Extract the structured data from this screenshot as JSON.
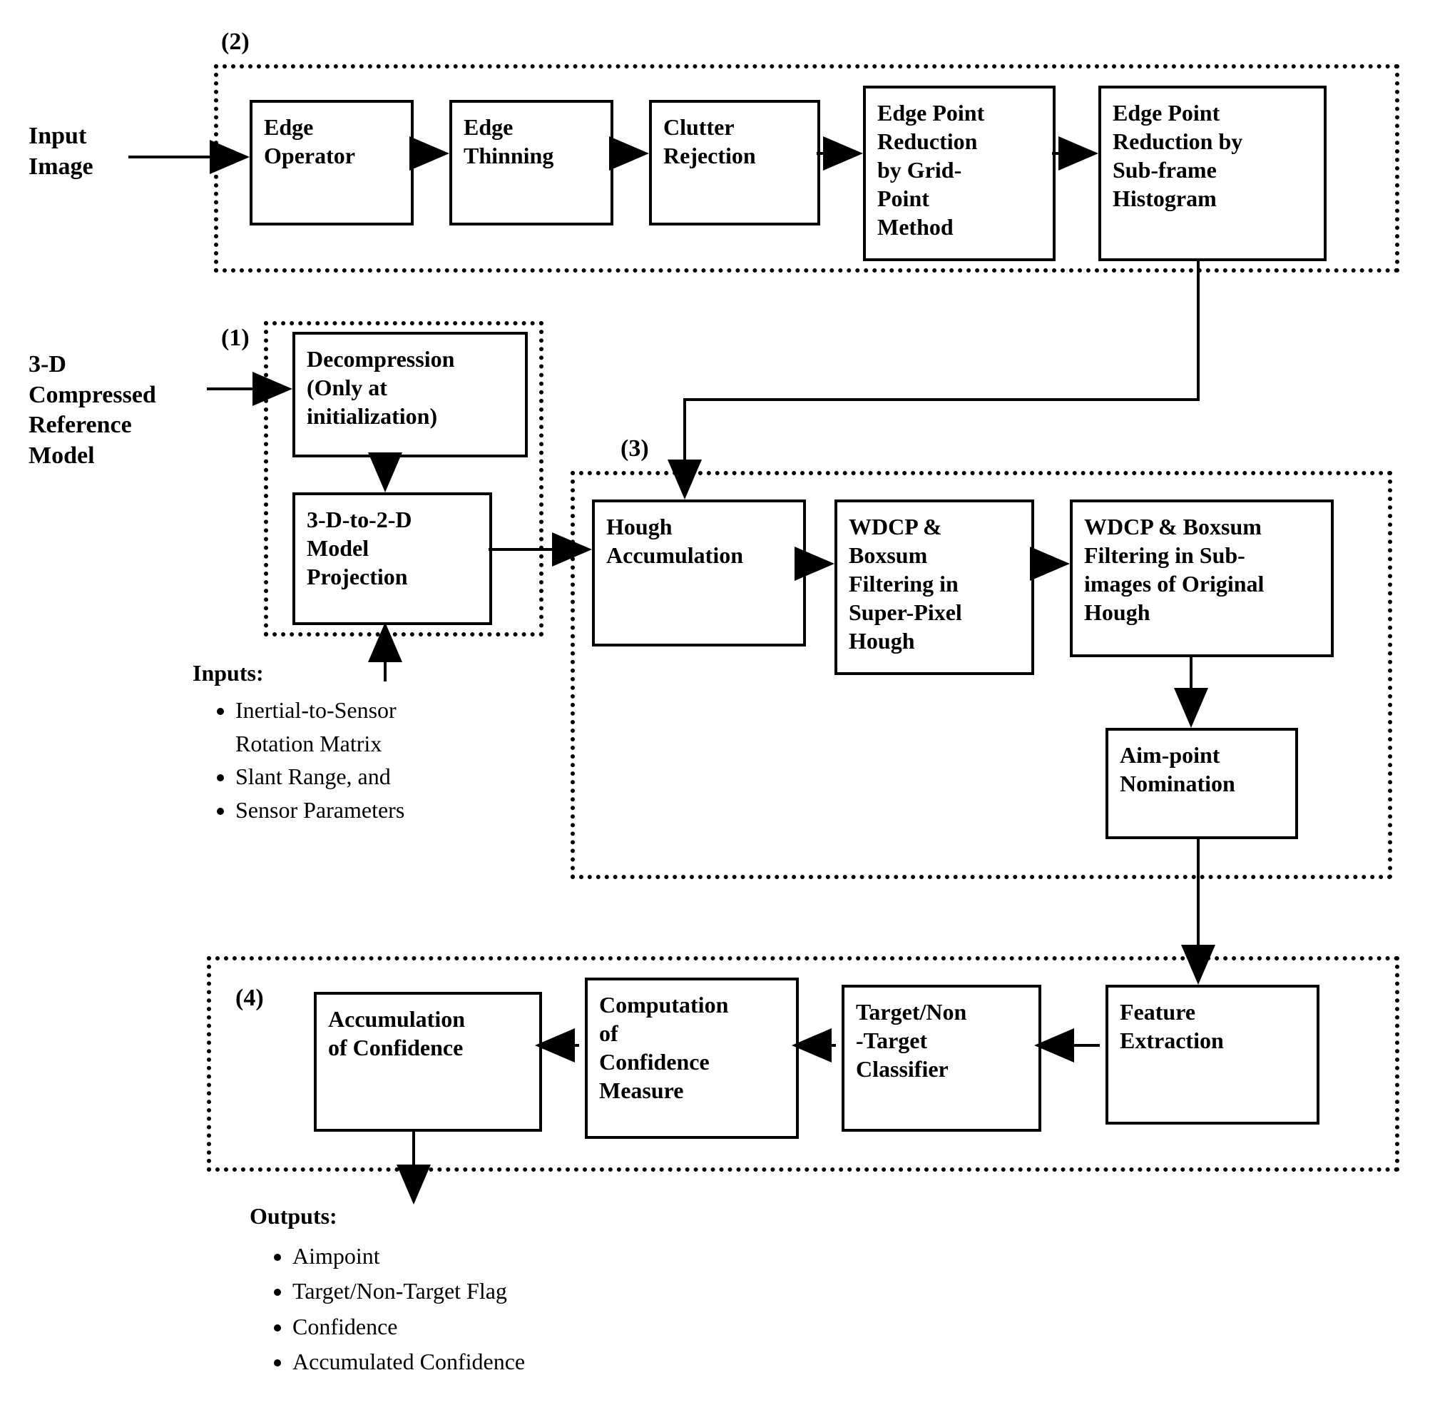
{
  "labels": {
    "input_image": "Input\nImage",
    "ref_model": "3-D\nCompressed\nReference\nModel",
    "group1": "(1)",
    "group2": "(2)",
    "group3": "(3)",
    "group4": "(4)",
    "inputs_header": "Inputs:",
    "outputs_header": "Outputs:"
  },
  "boxes": {
    "edge_operator": "Edge\nOperator",
    "edge_thinning": "Edge\nThinning",
    "clutter_rejection": "Clutter\nRejection",
    "edge_reduction_grid": "Edge Point\nReduction\nby Grid-\nPoint\nMethod",
    "edge_reduction_hist": "Edge Point\nReduction by\nSub-frame\nHistogram",
    "decompression": "Decompression\n(Only at\ninitialization)",
    "model_projection": "3-D-to-2-D\nModel\nProjection",
    "hough_accum": "Hough\nAccumulation",
    "wdcp_super": "WDCP &\nBoxsum\nFiltering in\nSuper-Pixel\nHough",
    "wdcp_sub": "WDCP & Boxsum\nFiltering in Sub-\nimages of Original\nHough",
    "aimpoint_nom": "Aim-point\nNomination",
    "feature_extraction": "Feature\nExtraction",
    "classifier": "Target/Non\n-Target\nClassifier",
    "conf_measure": "Computation\nof\nConfidence\nMeasure",
    "accum_conf": "Accumulation\nof Confidence"
  },
  "inputs_list": [
    "Inertial-to-Sensor\nRotation Matrix",
    "Slant Range, and",
    "Sensor Parameters"
  ],
  "outputs_list": [
    "Aimpoint",
    "Target/Non-Target Flag",
    "Confidence",
    "Accumulated Confidence"
  ]
}
